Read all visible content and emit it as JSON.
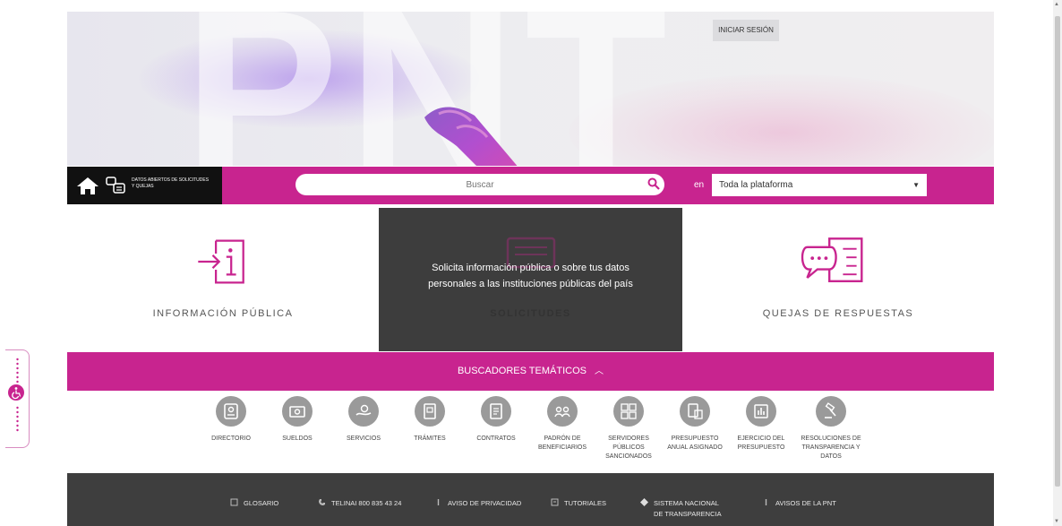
{
  "hero": {
    "watermark": "PNT",
    "login_label": "INICIAR SESIÓN"
  },
  "searchbar": {
    "home_icon": "home-icon",
    "datos_label": "DATOS ABIERTOS DE SOLICITUDES Y QUEJAS",
    "search_placeholder": "Buscar",
    "en_label": "en",
    "scope_value": "Toda la plataforma"
  },
  "tiles": {
    "informacion": "INFORMACIÓN PÚBLICA",
    "solicitudes": "SOLICITUDES",
    "solicitudes_overlay_1": "Solicita información pública o sobre tus datos",
    "solicitudes_overlay_2": "personales a las instituciones públicas del país",
    "quejas": "QUEJAS DE RESPUESTAS"
  },
  "buscadores": {
    "label": "BUSCADORES TEMÁTICOS"
  },
  "themes": [
    {
      "lines": [
        "DIRECTORIO"
      ]
    },
    {
      "lines": [
        "SUELDOS"
      ]
    },
    {
      "lines": [
        "SERVICIOS"
      ]
    },
    {
      "lines": [
        "TRÁMITES"
      ]
    },
    {
      "lines": [
        "CONTRATOS"
      ]
    },
    {
      "lines": [
        "PADRÓN DE",
        "BENEFICIARIOS"
      ]
    },
    {
      "lines": [
        "SERVIDORES",
        "PÚBLICOS",
        "SANCIONADOS"
      ]
    },
    {
      "lines": [
        "PRESUPUESTO",
        "ANUAL ASIGNADO"
      ]
    },
    {
      "lines": [
        "EJERCICIO DEL",
        "PRESUPUESTO"
      ]
    },
    {
      "lines": [
        "RESOLUCIONES DE",
        "TRANSPARENCIA Y",
        "DATOS"
      ]
    }
  ],
  "footer": {
    "glosario": "GLOSARIO",
    "telinai": "TELINAI 800 835 43 24",
    "aviso": "AVISO DE PRIVACIDAD",
    "tutoriales": "TUTORIALES",
    "sistema_1": "SISTEMA NACIONAL",
    "sistema_2": "DE TRANSPARENCIA",
    "avisos": "AVISOS DE LA PNT"
  },
  "colors": {
    "magenta": "#c8248f",
    "dark": "#3e3e3e"
  }
}
